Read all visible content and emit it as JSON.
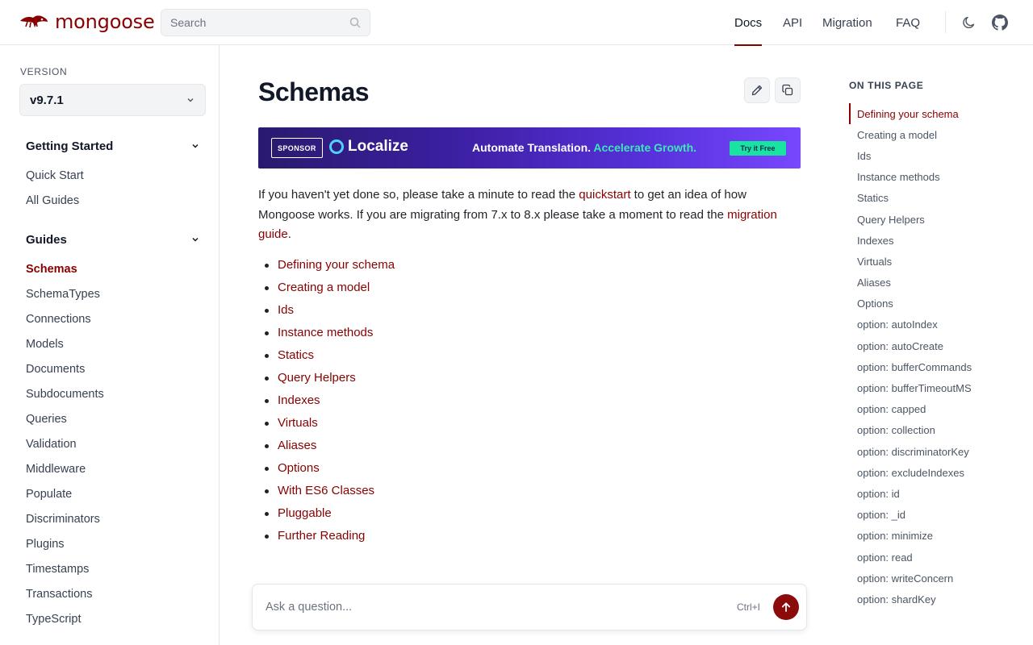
{
  "header": {
    "brand": "mongoose",
    "search_placeholder": "Search",
    "nav": [
      {
        "label": "Docs",
        "active": true
      },
      {
        "label": "API",
        "active": false
      },
      {
        "label": "Migration",
        "active": false
      },
      {
        "label": "FAQ",
        "active": false
      }
    ],
    "icons": [
      "moon-icon",
      "github-icon"
    ]
  },
  "sidebar": {
    "version_label": "VERSION",
    "version_value": "v9.7.1",
    "sections": [
      {
        "title": "Getting Started",
        "items": [
          "Quick Start",
          "All Guides"
        ]
      },
      {
        "title": "Guides",
        "items": [
          "Schemas",
          "SchemaTypes",
          "Connections",
          "Models",
          "Documents",
          "Subdocuments",
          "Queries",
          "Validation",
          "Middleware",
          "Populate",
          "Discriminators",
          "Plugins",
          "Timestamps",
          "Transactions",
          "TypeScript"
        ]
      }
    ],
    "active_item": "Schemas"
  },
  "main": {
    "title": "Schemas",
    "sponsor": {
      "badge": "SPONSOR",
      "brand": "Localize",
      "tagline_1": "Automate Translation.",
      "tagline_2": "Accelerate Growth.",
      "cta": "Try it Free"
    },
    "intro": {
      "p1": "If you haven't yet done so, please take a minute to read the ",
      "link1": "quickstart",
      "p2": " to get an idea of how Mongoose works. If you are migrating from 7.x to 8.x please take a moment to read the ",
      "link2": "migration guide",
      "p3": "."
    },
    "toc": [
      "Defining your schema",
      "Creating a model",
      "Ids",
      "Instance methods",
      "Statics",
      "Query Helpers",
      "Indexes",
      "Virtuals",
      "Aliases",
      "Options",
      "With ES6 Classes",
      "Pluggable",
      "Further Reading"
    ],
    "ask": {
      "placeholder": "Ask a question...",
      "shortcut": "Ctrl+I"
    }
  },
  "on_this_page": {
    "title": "ON THIS PAGE",
    "items": [
      "Defining your schema",
      "Creating a model",
      "Ids",
      "Instance methods",
      "Statics",
      "Query Helpers",
      "Indexes",
      "Virtuals",
      "Aliases",
      "Options",
      "option: autoIndex",
      "option: autoCreate",
      "option: bufferCommands",
      "option: bufferTimeoutMS",
      "option: capped",
      "option: collection",
      "option: discriminatorKey",
      "option: excludeIndexes",
      "option: id",
      "option: _id",
      "option: minimize",
      "option: read",
      "option: writeConcern",
      "option: shardKey"
    ],
    "active": "Defining your schema"
  },
  "colors": {
    "accent": "#880000",
    "border": "#e5e7eb",
    "muted_bg": "#f3f4f6"
  }
}
